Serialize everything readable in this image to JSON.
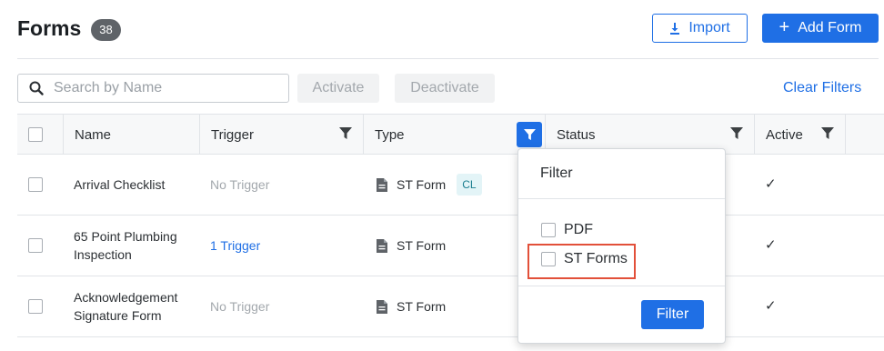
{
  "header": {
    "title": "Forms",
    "count": "38",
    "import_label": "Import",
    "add_form_label": "Add Form"
  },
  "toolbar": {
    "search_placeholder": "Search by Name",
    "activate_label": "Activate",
    "deactivate_label": "Deactivate",
    "clear_filters_label": "Clear Filters"
  },
  "table": {
    "columns": [
      "Name",
      "Trigger",
      "Type",
      "Status",
      "Active"
    ],
    "rows": [
      {
        "name": "Arrival Checklist",
        "trigger": "No Trigger",
        "type": "ST Form",
        "badge": "CL",
        "active": "✓"
      },
      {
        "name": "65 Point Plumbing Inspection",
        "trigger": "1 Trigger",
        "type": "ST Form",
        "badge": "",
        "active": "✓"
      },
      {
        "name": "Acknowledgement Signature Form",
        "trigger": "No Trigger",
        "type": "ST Form",
        "badge": "",
        "active": "✓"
      }
    ]
  },
  "type_filter_popup": {
    "title": "Filter",
    "options": [
      "PDF",
      "ST Forms"
    ],
    "apply_label": "Filter"
  },
  "colors": {
    "primary": "#1f6fe5",
    "highlight": "#e2503a",
    "badge_bg": "#5f6368"
  },
  "icons": [
    "download-icon",
    "plus-icon",
    "search-icon",
    "filter-icon",
    "document-icon",
    "checkmark-icon"
  ]
}
